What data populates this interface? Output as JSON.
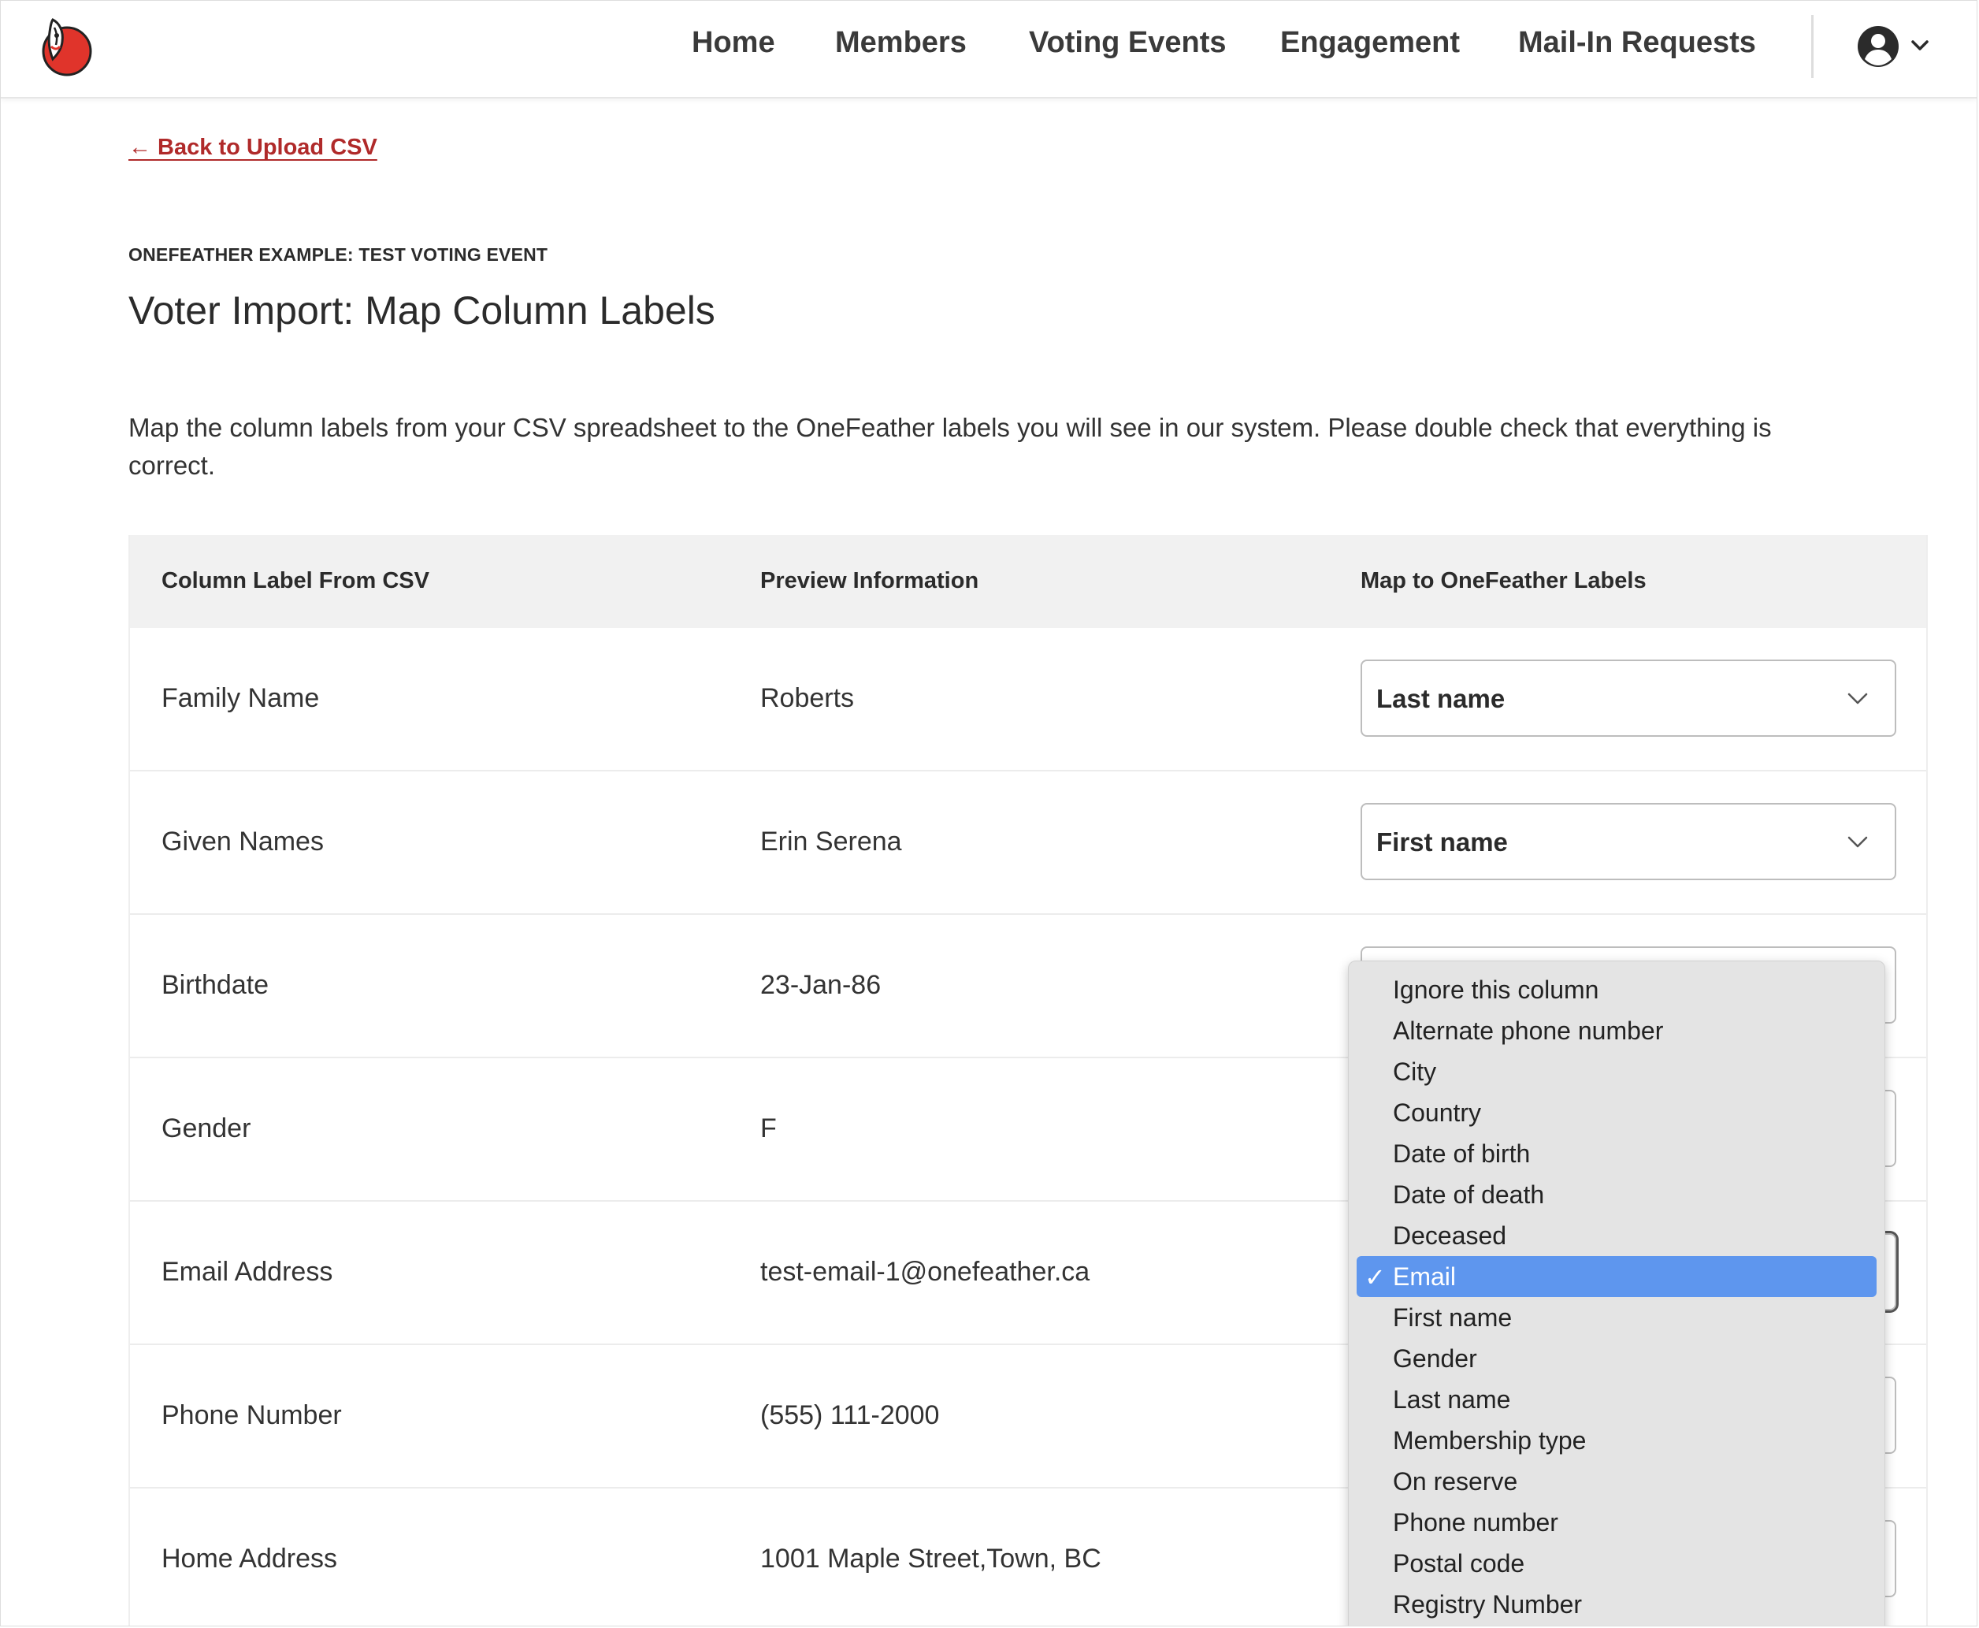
{
  "colors": {
    "accent": "#b02a2a",
    "logo_red": "#e0342b",
    "menu_highlight": "#5e96ee",
    "table_header_bg": "#f1f1f1"
  },
  "header": {
    "logo_icon": "onefeather-logo",
    "nav": [
      "Home",
      "Members",
      "Voting Events",
      "Engagement",
      "Mail-In Requests"
    ],
    "account_icon": "user-circle-icon",
    "account_menu_icon": "chevron-down-icon"
  },
  "back_link": "← Back to Upload CSV",
  "eyebrow": "ONEFEATHER EXAMPLE: TEST VOTING EVENT",
  "page_title": "Voter Import: Map Column Labels",
  "intro": "Map the column labels from your CSV spreadsheet to the OneFeather labels you will see in our system. Please double check that everything is correct.",
  "table": {
    "headers": [
      "Column Label From CSV",
      "Preview Information",
      "Map to OneFeather Labels"
    ],
    "rows": [
      {
        "csv_label": "Family Name",
        "preview": "Roberts",
        "mapped": "Last name"
      },
      {
        "csv_label": "Given Names",
        "preview": "Erin Serena",
        "mapped": "First name"
      },
      {
        "csv_label": "Birthdate",
        "preview": "23-Jan-86",
        "mapped": ""
      },
      {
        "csv_label": "Gender",
        "preview": "F",
        "mapped": ""
      },
      {
        "csv_label": "Email Address",
        "preview": "test-email-1@onefeather.ca",
        "mapped": ""
      },
      {
        "csv_label": "Phone Number",
        "preview": "(555) 111-2000",
        "mapped": ""
      },
      {
        "csv_label": "Home Address",
        "preview": "1001 Maple Street,Town, BC",
        "mapped": ""
      }
    ]
  },
  "dropdown": {
    "check_mark": "✓",
    "selected_index": 7,
    "options": [
      "Ignore this column",
      "Alternate phone number",
      "City",
      "Country",
      "Date of birth",
      "Date of death",
      "Deceased",
      "Email",
      "First name",
      "Gender",
      "Last name",
      "Membership type",
      "On reserve",
      "Phone number",
      "Postal code",
      "Registry Number"
    ]
  }
}
